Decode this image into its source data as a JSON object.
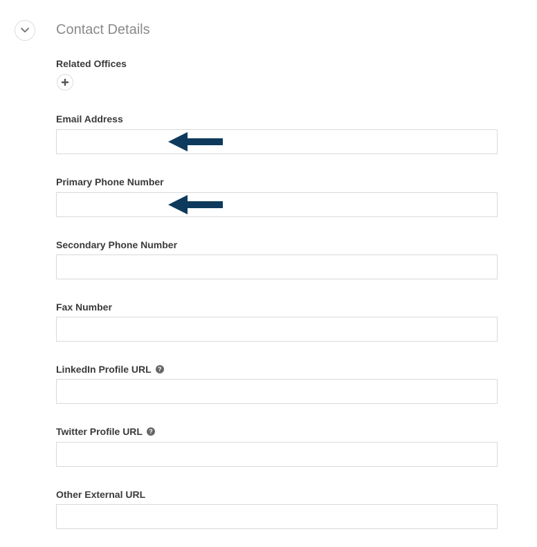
{
  "section": {
    "title": "Contact Details",
    "toggle_icon": "chevron-down-icon"
  },
  "related_offices": {
    "label": "Related Offices",
    "add_icon": "plus-icon"
  },
  "fields": {
    "email": {
      "label": "Email Address",
      "value": ""
    },
    "primary_phone": {
      "label": "Primary Phone Number",
      "value": ""
    },
    "secondary_phone": {
      "label": "Secondary Phone Number",
      "value": ""
    },
    "fax": {
      "label": "Fax Number",
      "value": ""
    },
    "linkedin": {
      "label": "LinkedIn Profile URL",
      "value": "",
      "help_icon": "question-circle-icon"
    },
    "twitter": {
      "label": "Twitter Profile URL",
      "value": "",
      "help_icon": "question-circle-icon"
    },
    "other_url": {
      "label": "Other External URL",
      "value": ""
    }
  },
  "annotations": {
    "arrow_color": "#0d3a5c",
    "arrow_icon": "left-arrow-icon"
  }
}
